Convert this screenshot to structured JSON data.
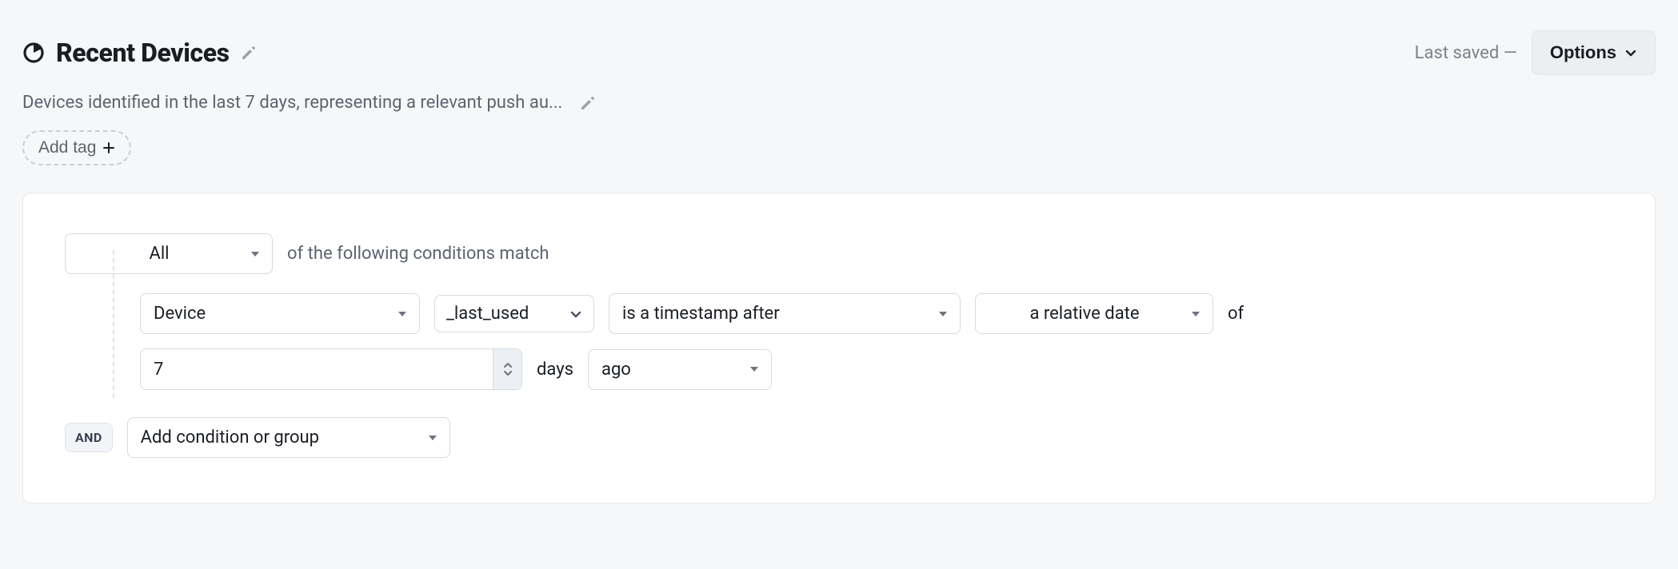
{
  "header": {
    "title": "Recent Devices",
    "last_saved": "Last saved —",
    "options_label": "Options"
  },
  "description": "Devices identified in the last 7 days, representing a relevant push au...",
  "tags": {
    "add_label": "Add tag"
  },
  "builder": {
    "match_mode": "All",
    "match_tail": "of the following conditions match",
    "condition": {
      "entity": "Device",
      "attribute": "_last_used",
      "operator": "is a timestamp after",
      "basis": "a relative date",
      "of_label": "of",
      "amount": "7",
      "unit_label": "days",
      "direction": "ago"
    },
    "and_label": "AND",
    "add_condition_label": "Add condition or group"
  }
}
